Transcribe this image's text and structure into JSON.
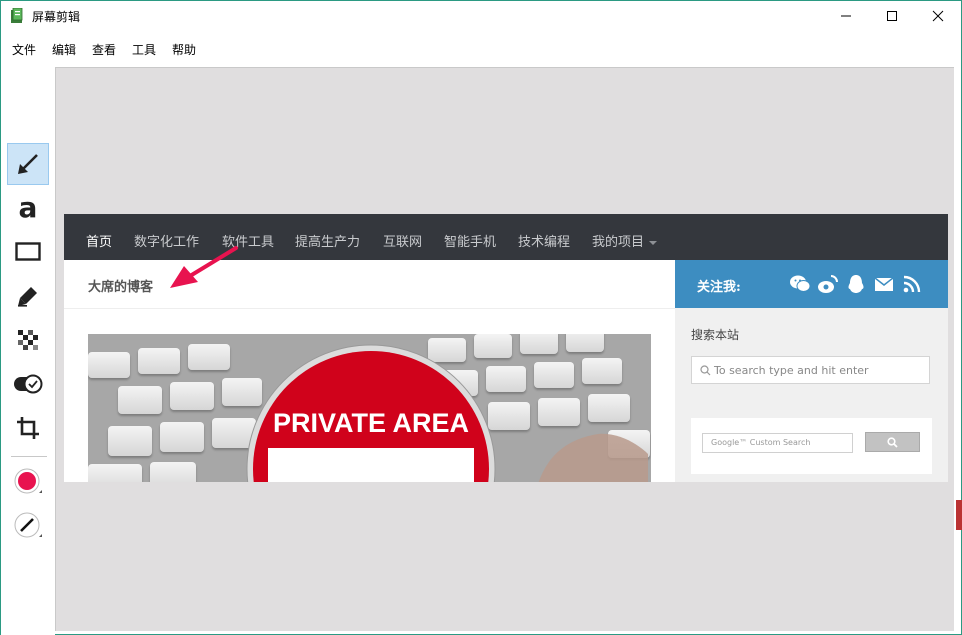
{
  "window": {
    "title": "屏幕剪辑",
    "buttons": [
      "minimize",
      "maximize",
      "close"
    ]
  },
  "menu": [
    "文件",
    "编辑",
    "查看",
    "工具",
    "帮助"
  ],
  "toolbar": {
    "tools": [
      "arrow-tool",
      "text-tool",
      "rectangle-tool",
      "pen-tool",
      "pixelate-tool",
      "toggle-tool",
      "crop-tool"
    ],
    "text_tool_glyph": "a",
    "active_tool": "arrow-tool",
    "color": "#e8134f",
    "line_width_tool": "line-width-tool"
  },
  "screenshot": {
    "nav": [
      "首页",
      "数字化工作",
      "软件工具",
      "提高生产力",
      "互联网",
      "智能手机",
      "技术编程",
      "我的项目"
    ],
    "blog_title": "大席的博客",
    "follow_label": "关注我:",
    "social_icons": [
      "wechat-icon",
      "weibo-icon",
      "qq-icon",
      "mail-icon",
      "rss-icon"
    ],
    "search_title": "搜索本站",
    "search_placeholder": "To search type and hit enter",
    "google_label": "Google™ Custom Search",
    "hero_sign_text": "PRIVATE AREA",
    "annotation_color": "#e8134f"
  }
}
